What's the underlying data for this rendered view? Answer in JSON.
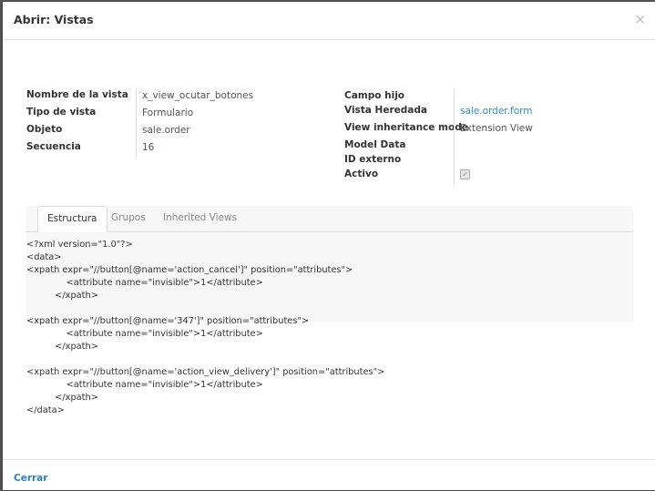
{
  "modal": {
    "title": "Abrir: Vistas",
    "close_icon": "×"
  },
  "left_fields": [
    {
      "label": "Nombre de la vista",
      "value": "x_view_ocutar_botones"
    },
    {
      "label": "Tipo de vista",
      "value": "Formulario"
    },
    {
      "label": "Objeto",
      "value": "sale.order"
    },
    {
      "label": "Secuencia",
      "value": "16"
    }
  ],
  "right_fields": [
    {
      "label": "Campo hijo",
      "value": ""
    },
    {
      "label": "Vista Heredada",
      "value": "sale.order.form"
    },
    {
      "label": "View inheritance mode",
      "value": "Extension View"
    },
    {
      "label": "Model Data",
      "value": ""
    },
    {
      "label": "ID externo",
      "value": ""
    },
    {
      "label": "Activo",
      "value": "",
      "checked": true
    }
  ],
  "tabs": [
    "Estructura",
    "Grupos",
    "Inherited Views"
  ],
  "active_tab": "Estructura",
  "code_lines": [
    "<?xml version=\"1.0\"?>",
    "<data>",
    "<xpath expr=\"//button[@name='action_cancel']\" position=\"attributes\">",
    "              <attribute name=\"invisible\">1</attribute>",
    "          </xpath>",
    "",
    "<xpath expr=\"//button[@name='347']\" position=\"attributes\">",
    "              <attribute name=\"invisible\">1</attribute>",
    "          </xpath>",
    "",
    "<xpath expr=\"//button[@name='action_view_delivery']\" position=\"attributes\">",
    "              <attribute name=\"invisible\">1</attribute>",
    "          </xpath>",
    "</data>"
  ],
  "footer": {
    "close_label": "Cerrar"
  }
}
